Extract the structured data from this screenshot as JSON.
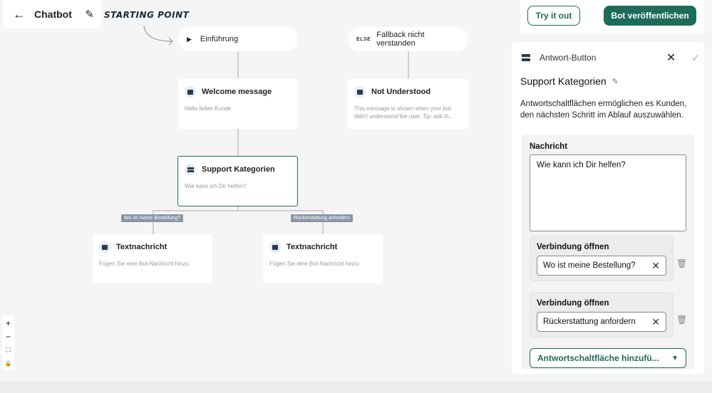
{
  "header": {
    "title": "Chatbot",
    "back_icon": "arrow-left-icon",
    "edit_icon": "pencil-icon"
  },
  "canvas": {
    "starting_point_label": "STARTING POINT",
    "start_node": {
      "label": "Einführung"
    },
    "fallback_node": {
      "badge": "ELSE",
      "label": "Fallback nicht verstanden"
    },
    "welcome_node": {
      "title": "Welcome message",
      "desc": "Hallo lieber Kunde"
    },
    "not_understood_node": {
      "title": "Not Understood",
      "desc": "This message is shown when your bot didn't understand the user. Tip: ask th..."
    },
    "support_node": {
      "title": "Support Kategorien",
      "desc": "Wie kann ich Dir helfen?"
    },
    "branch_tags": [
      "Wo ist meine Bestellung?",
      "Rückerstattung anfordern"
    ],
    "text_nodes": [
      {
        "title": "Textnachricht",
        "desc": "Fügen Sie eine Bot-Nachricht hinzu"
      },
      {
        "title": "Textnachricht",
        "desc": "Fügen Sie eine Bot-Nachricht hinzu"
      }
    ],
    "zoom": {
      "plus": "+",
      "minus": "−",
      "fit": "⛶",
      "lock": "🔒"
    }
  },
  "toolbar": {
    "try_label": "Try it out",
    "publish_label": "Bot veröffentlichen"
  },
  "panel": {
    "type_label": "Antwort-Button",
    "title": "Support Kategorien",
    "description": "Antwortschaltflächen ermöglichen es Kunden, den nächsten Schritt im Ablauf auszuwählen.",
    "message_label": "Nachricht",
    "message_value": "Wie kann ich Dir helfen?",
    "connections": [
      {
        "label": "Verbindung öffnen",
        "value": "Wo ist meine Bestellung?"
      },
      {
        "label": "Verbindung öffnen",
        "value": "Rückerstattung anfordern"
      }
    ],
    "add_button_label": "Antwortschaltfläche hinzufü..."
  },
  "colors": {
    "accent": "#1d6b5a",
    "tag_bg": "#8a96a6"
  }
}
